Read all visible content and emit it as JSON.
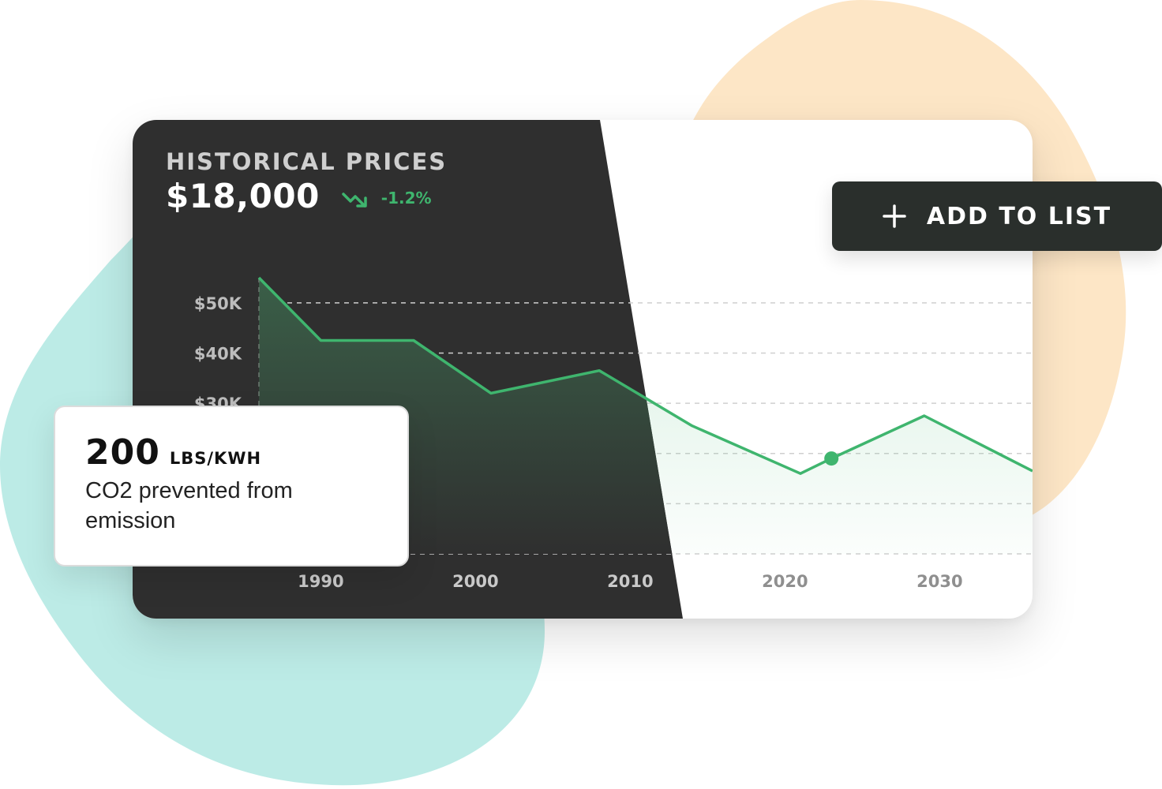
{
  "colors": {
    "dark_panel": "#2f2f2f",
    "line": "#3fb56e",
    "button_bg": "#2a2f2c",
    "mint_blob": "#bcebe6",
    "peach_blob": "#fde6c6"
  },
  "card": {
    "title": "HISTORICAL PRICES",
    "price": "$18,000",
    "change": "-1.2%",
    "trend_icon": "trend-down-icon"
  },
  "add_button": {
    "label": "ADD TO LIST",
    "icon": "plus-icon"
  },
  "stat": {
    "value": "200",
    "unit": "LBS/KWH",
    "caption": "CO2 prevented from emission"
  },
  "chart_data": {
    "type": "area",
    "title": "HISTORICAL PRICES",
    "y_tick_labels": [
      "$50K",
      "$40K",
      "$30K"
    ],
    "y_ticks": [
      50000,
      40000,
      30000,
      20000,
      10000,
      0
    ],
    "x_tick_labels": [
      "1990",
      "2000",
      "2010",
      "2020",
      "2030"
    ],
    "x_ticks": [
      1990,
      2000,
      2010,
      2020,
      2030
    ],
    "xlim": [
      1986,
      2036
    ],
    "ylim": [
      0,
      55000
    ],
    "grid": true,
    "highlight_index": 7,
    "series": [
      {
        "x": [
          1986,
          1990,
          1996,
          2001,
          2008,
          2014,
          2021,
          2023,
          2029,
          2036
        ],
        "values": [
          55000,
          42500,
          42500,
          32000,
          36500,
          25500,
          16000,
          19000,
          27500,
          16500
        ]
      }
    ]
  }
}
